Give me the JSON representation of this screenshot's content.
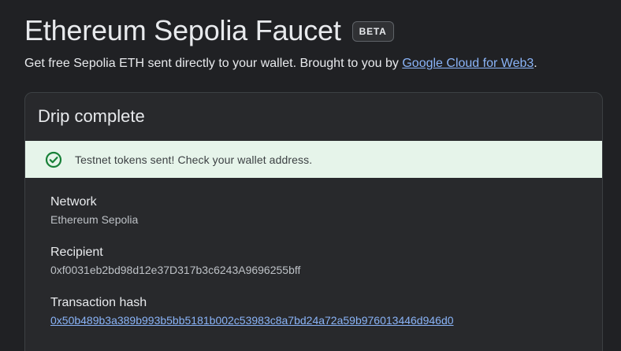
{
  "header": {
    "title": "Ethereum Sepolia Faucet",
    "badge": "BETA",
    "subtitle_prefix": "Get free Sepolia ETH sent directly to your wallet. Brought to you by ",
    "subtitle_link": "Google Cloud for Web3",
    "subtitle_suffix": "."
  },
  "card": {
    "title": "Drip complete",
    "alert": {
      "icon": "check-circle-icon",
      "text": "Testnet tokens sent! Check your wallet address."
    },
    "fields": [
      {
        "label": "Network",
        "value": "Ethereum Sepolia"
      },
      {
        "label": "Recipient",
        "value": "0xf0031eb2bd98d12e37D317b3c6243A9696255bff"
      },
      {
        "label": "Transaction hash",
        "value": "0x50b489b3a389b993b5bb5181b002c53983c8a7bd24a72a59b976013446d946d0"
      }
    ]
  },
  "colors": {
    "background": "#202124",
    "card": "#28292c",
    "alert_bg": "#e6f4ea",
    "success": "#188038",
    "link": "#8ab4f8"
  }
}
